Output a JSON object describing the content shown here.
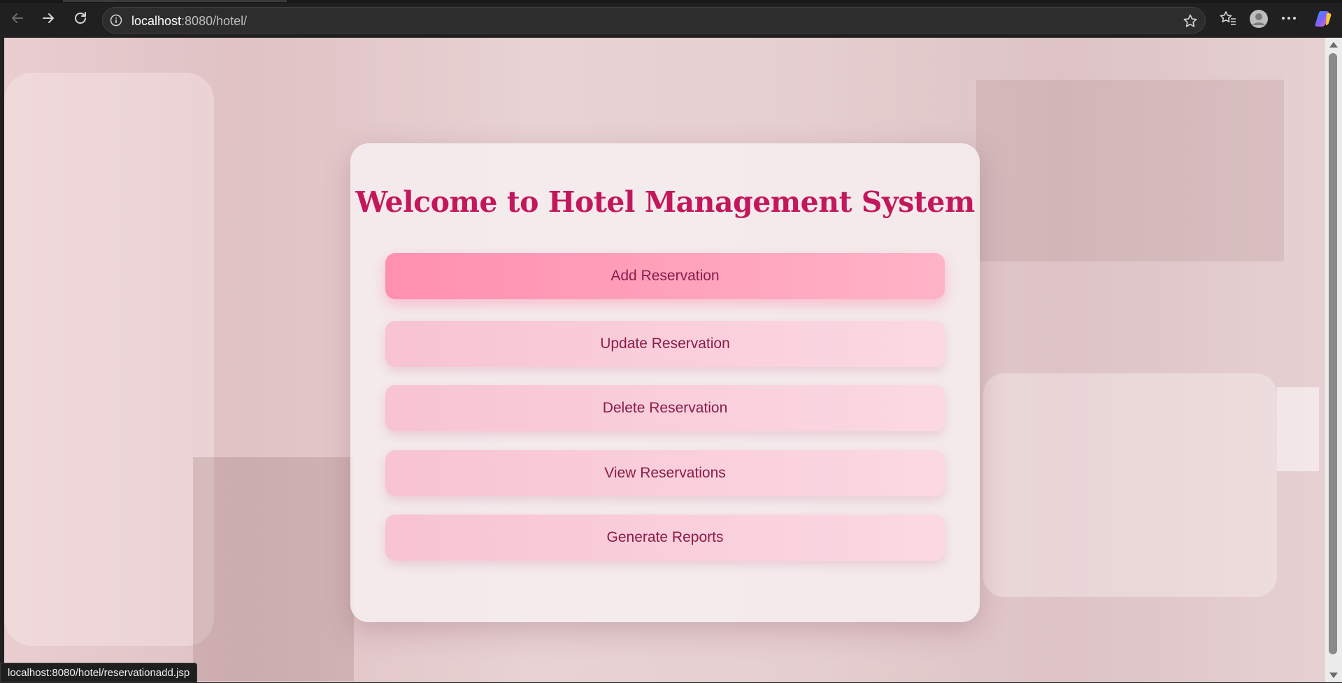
{
  "browser": {
    "url_host": "localhost",
    "url_rest": ":8080/hotel/",
    "status_url": "localhost:8080/hotel/reservationadd.jsp"
  },
  "page": {
    "title": "Welcome to Hotel Management System",
    "buttons": [
      {
        "label": "Add Reservation",
        "state": "hover"
      },
      {
        "label": "Update Reservation"
      },
      {
        "label": "Delete Reservation"
      },
      {
        "label": "View Reservations"
      },
      {
        "label": "Generate Reports"
      }
    ]
  },
  "icons": [
    "back-icon",
    "forward-icon",
    "refresh-icon",
    "info-icon",
    "star-icon",
    "favorites-icon",
    "profile-icon",
    "more-icon",
    "copilot-icon"
  ],
  "colors": {
    "title": "#c2185b",
    "button_text": "#8a1c4a",
    "button_active": "#ff8fb0",
    "button_default": "#f8c3d2"
  }
}
